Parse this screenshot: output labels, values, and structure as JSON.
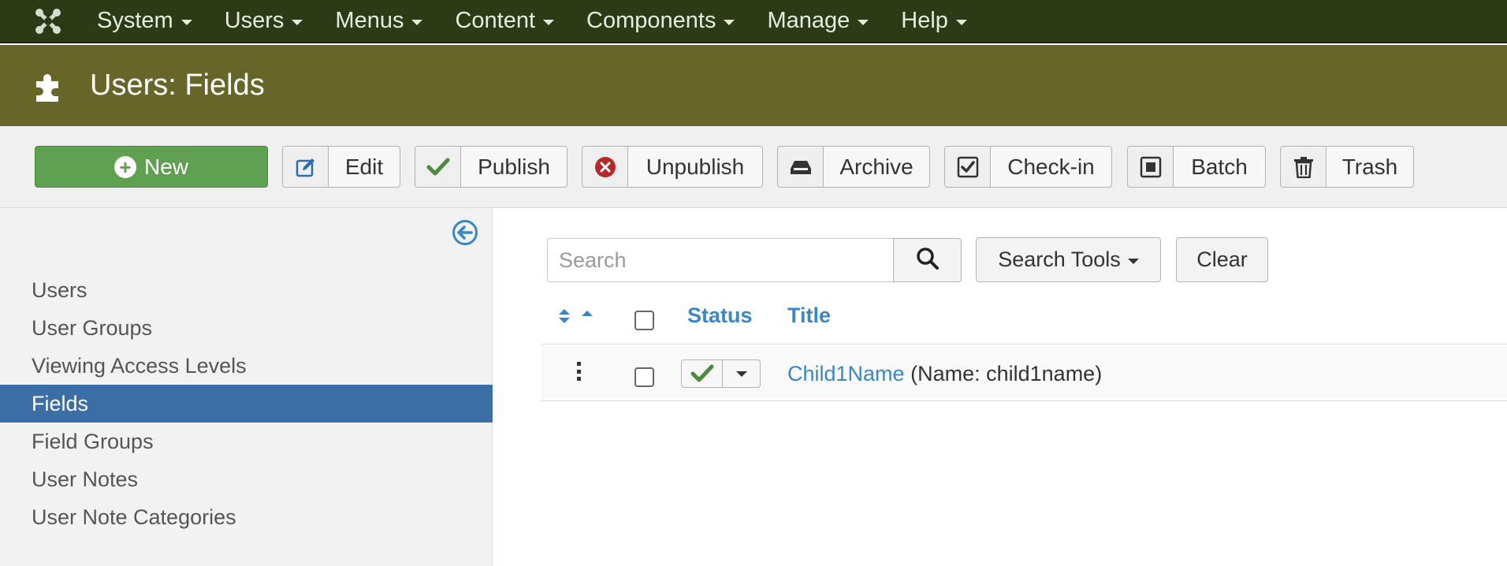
{
  "topnav": {
    "items": [
      {
        "label": "System"
      },
      {
        "label": "Users"
      },
      {
        "label": "Menus"
      },
      {
        "label": "Content"
      },
      {
        "label": "Components"
      },
      {
        "label": "Manage"
      },
      {
        "label": "Help"
      }
    ]
  },
  "header": {
    "title": "Users: Fields",
    "icon": "puzzle-piece-icon"
  },
  "toolbar": {
    "new_label": "New",
    "edit_label": "Edit",
    "publish_label": "Publish",
    "unpublish_label": "Unpublish",
    "archive_label": "Archive",
    "checkin_label": "Check-in",
    "batch_label": "Batch",
    "trash_label": "Trash"
  },
  "sidebar": {
    "items": [
      {
        "label": "Users",
        "active": false
      },
      {
        "label": "User Groups",
        "active": false
      },
      {
        "label": "Viewing Access Levels",
        "active": false
      },
      {
        "label": "Fields",
        "active": true
      },
      {
        "label": "Field Groups",
        "active": false
      },
      {
        "label": "User Notes",
        "active": false
      },
      {
        "label": "User Note Categories",
        "active": false
      }
    ]
  },
  "search": {
    "placeholder": "Search",
    "value": "",
    "tools_label": "Search Tools",
    "clear_label": "Clear"
  },
  "table": {
    "columns": {
      "status": "Status",
      "title": "Title"
    },
    "rows": [
      {
        "title": "Child1Name",
        "meta": "(Name: child1name)",
        "status": "published"
      }
    ]
  },
  "colors": {
    "topbar": "#2c3b16",
    "header": "#676527",
    "new_button": "#5fa151",
    "active_sidebar": "#3b6ea4",
    "link": "#3a87c8"
  }
}
